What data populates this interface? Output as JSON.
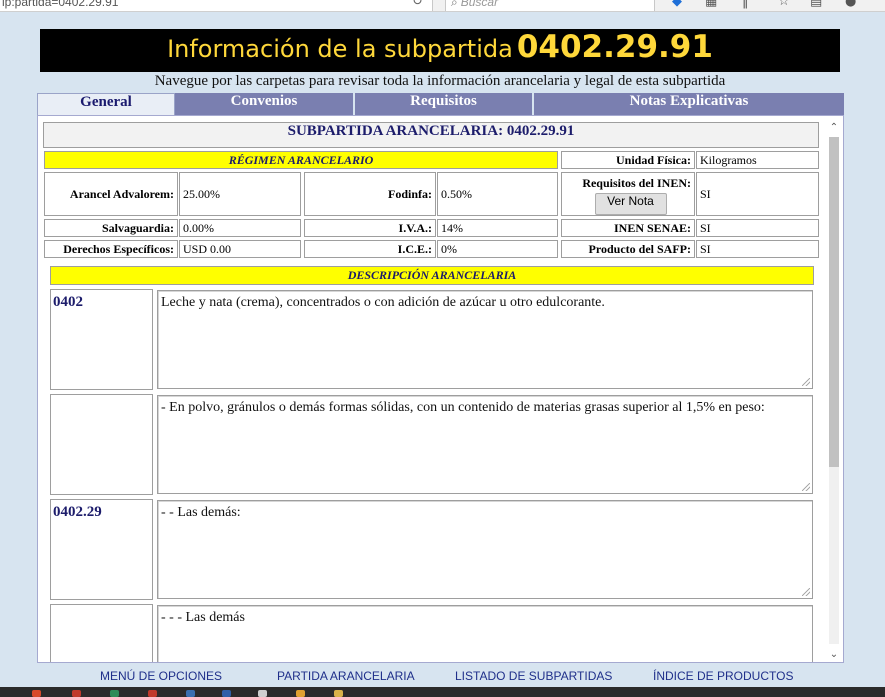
{
  "browser": {
    "url_fragment": "ip:partida=0402.29.91",
    "search_placeholder": "Buscar"
  },
  "header": {
    "title_prefix": "Información de la subpartida",
    "title_code": "0402.29.91",
    "subtitle": "Navegue por las carpetas para revisar toda la información arancelaria y legal de esta subpartida"
  },
  "tabs": [
    {
      "label": "General",
      "active": true
    },
    {
      "label": "Convenios"
    },
    {
      "label": "Requisitos"
    },
    {
      "label": "Notas Explicativas"
    }
  ],
  "main": {
    "heading": "SUBPARTIDA ARANCELARIA: 0402.29.91",
    "regimen_title": "RÉGIMEN ARANCELARIO",
    "unidad_label": "Unidad Física:",
    "unidad_value": "Kilogramos",
    "arancel_label": "Arancel Advalorem:",
    "arancel_value": "25.00%",
    "fodinfa_label": "Fodinfa:",
    "fodinfa_value": "0.50%",
    "inen_req_label": "Requisitos del INEN:",
    "ver_nota_label": "Ver Nota",
    "inen_req_value": "SI",
    "salvaguardia_label": "Salvaguardia:",
    "salvaguardia_value": "0.00%",
    "iva_label": "I.V.A.:",
    "iva_value": "14%",
    "inen_senae_label": "INEN SENAE:",
    "inen_senae_value": "SI",
    "derechos_label": "Derechos Específicos:",
    "derechos_value": "USD 0.00",
    "ice_label": "I.C.E.:",
    "ice_value": "0%",
    "safp_label": "Producto del SAFP:",
    "safp_value": "SI",
    "descripcion_title": "DESCRIPCIÓN ARANCELARIA",
    "descripcion_rows": [
      {
        "code": "0402",
        "text": "Leche y nata (crema), concentrados o con adición de azúcar u otro edulcorante."
      },
      {
        "code": "",
        "text": "- En polvo, gránulos o demás formas sólidas, con un contenido de materias grasas superior al 1,5% en peso:"
      },
      {
        "code": "0402.29",
        "text": "- - Las demás:"
      },
      {
        "code": "",
        "text": "- - - Las demás"
      }
    ]
  },
  "footer": {
    "links": [
      "MENÚ DE OPCIONES",
      "PARTIDA ARANCELARIA",
      "LISTADO DE SUBPARTIDAS",
      "ÍNDICE DE PRODUCTOS"
    ]
  }
}
